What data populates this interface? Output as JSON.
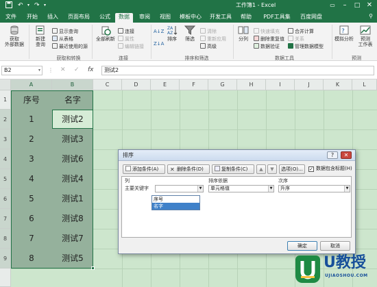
{
  "titlebar": {
    "title": "工作簿1 - Excel",
    "quick_access": [
      "save-icon",
      "undo-icon",
      "redo-icon",
      "customize-icon"
    ],
    "window_controls": [
      "ribbon-display-icon",
      "minimize-icon",
      "maximize-icon",
      "close-icon"
    ]
  },
  "tabs": [
    "文件",
    "开始",
    "插入",
    "页面布局",
    "公式",
    "数据",
    "审阅",
    "视图",
    "模板中心",
    "开发工具",
    "帮助",
    "PDF工具集",
    "百度网盘"
  ],
  "active_tab": "数据",
  "tab_search_icon": "lightbulb-icon",
  "ribbon": {
    "get_data": {
      "label1": "获取",
      "label2": "外部数据"
    },
    "new_query": {
      "label1": "新建",
      "label2": "查询"
    },
    "query_items": [
      "显示查询",
      "从表格",
      "最近使用的源"
    ],
    "group_get_transform": "获取和转换",
    "refresh_all": {
      "label1": "全部刷新"
    },
    "conn_items": [
      "连接",
      "属性",
      "编辑链接"
    ],
    "group_connections": "连接",
    "sort_small": [
      "A↓Z",
      "Z↓A"
    ],
    "sort": "排序",
    "filter": "筛选",
    "filter_items": [
      "清除",
      "重新应用",
      "高级"
    ],
    "group_sort_filter": "排序和筛选",
    "split": "分列",
    "tools_col1": [
      "快速填充",
      "删除重复值",
      "数据验证"
    ],
    "tools_col2": [
      "合并计算",
      "关系",
      "管理数据模型"
    ],
    "group_data_tools": "数据工具",
    "whatif": {
      "label1": "模拟分析"
    },
    "forecast_sheet": {
      "label1": "预测",
      "label2": "工作表"
    },
    "group_forecast": "预测",
    "accent": "#217346"
  },
  "formula_bar": {
    "name_box": "B2",
    "icons": [
      "cancel-icon",
      "enter-icon",
      "fx-icon"
    ],
    "fx": "fx",
    "content": "测试2"
  },
  "grid": {
    "columns": [
      "A",
      "B",
      "C",
      "D",
      "E",
      "F",
      "G",
      "H",
      "I",
      "J",
      "K",
      "L"
    ],
    "rows": [
      "1",
      "2",
      "3",
      "4",
      "5",
      "6",
      "7",
      "8",
      "9"
    ],
    "header": [
      "序号",
      "名字"
    ],
    "data": [
      [
        "1",
        "测试2"
      ],
      [
        "2",
        "测试3"
      ],
      [
        "3",
        "测试6"
      ],
      [
        "4",
        "测试4"
      ],
      [
        "5",
        "测试1"
      ],
      [
        "6",
        "测试8"
      ],
      [
        "7",
        "测试7"
      ],
      [
        "8",
        "测试5"
      ]
    ]
  },
  "dialog": {
    "title": "排序",
    "help": "?",
    "close": "✕",
    "add_level": "添加条件(A)",
    "delete_level": "删除条件(D)",
    "copy_level": "复制条件(C)",
    "options": "选项(O)...",
    "has_headers": "数据包含标题(H)",
    "has_headers_checked": true,
    "col_header": "列",
    "sort_on_header": "排序依据",
    "order_header": "次序",
    "sort_by_label": "主要关键字",
    "sort_by_value": "",
    "sort_on_value": "单元格值",
    "order_value": "升序",
    "dropdown_options": [
      "序号",
      "名字"
    ],
    "dropdown_highlight": 1,
    "ok": "确定",
    "cancel": "取消"
  },
  "watermark": {
    "text": "U教授",
    "url": "UJIAOSHOU.COM"
  }
}
